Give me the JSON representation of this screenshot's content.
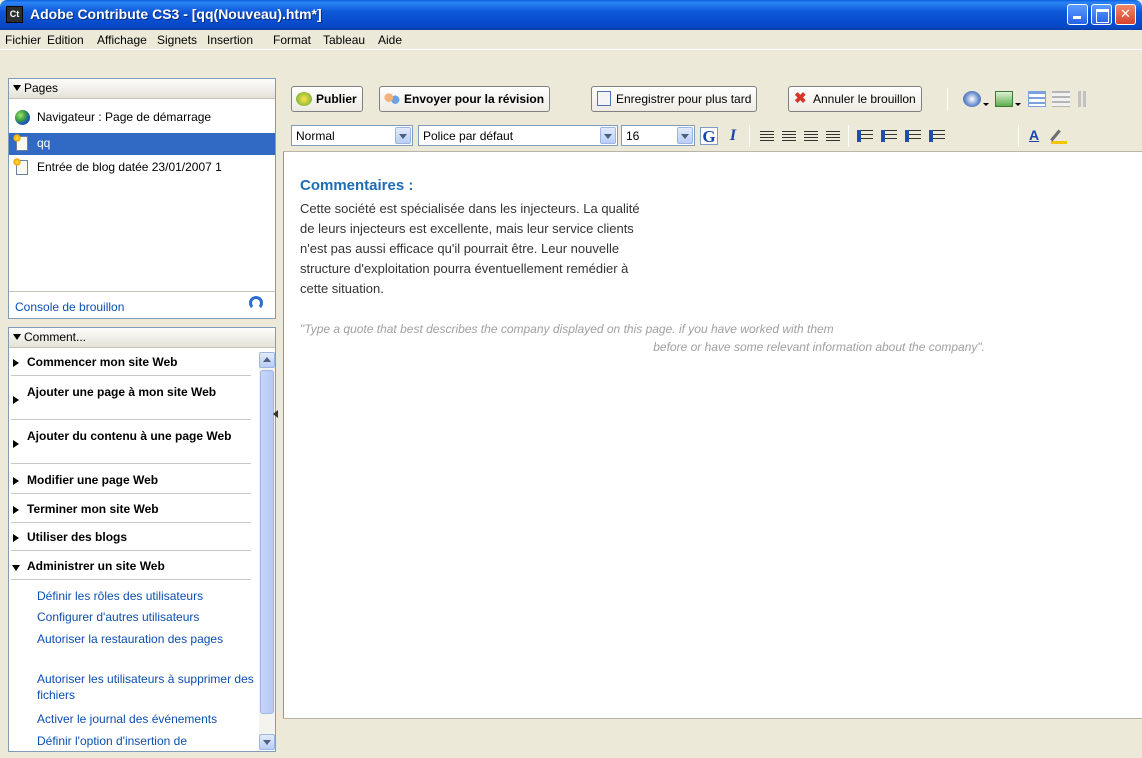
{
  "window": {
    "app_icon": "Ct",
    "title": "Adobe Contribute CS3 - [qq(Nouveau).htm*]"
  },
  "menu": [
    "Fichier",
    "Edition",
    "Affichage",
    "Signets",
    "Insertion",
    "Format",
    "Tableau",
    "Aide"
  ],
  "pages_panel": {
    "title": "Pages",
    "items": [
      {
        "label": "Navigateur : Page de démarrage",
        "icon": "globe-icon"
      },
      {
        "label": "qq",
        "icon": "new-page-icon",
        "selected": true
      },
      {
        "label": "Entrée de blog datée 23/01/2007 1",
        "icon": "new-page-icon"
      }
    ],
    "draft_console": "Console de brouillon"
  },
  "how_panel": {
    "title": "Comment...",
    "sections": [
      "Commencer mon site Web",
      "Ajouter une page à mon site Web",
      "Ajouter du contenu à une page Web",
      "Modifier une page Web",
      "Terminer mon site Web",
      "Utiliser des blogs",
      "Administrer un site Web"
    ],
    "links": [
      "Définir les rôles des utilisateurs",
      "Configurer d'autres utilisateurs",
      "Autoriser la restauration des pages",
      "Autoriser les utilisateurs à supprimer des fichiers",
      "Activer le journal des événements",
      "Définir l'option d'insertion de"
    ]
  },
  "toolbar": {
    "publish": "Publier",
    "send_review": "Envoyer pour la révision",
    "save_later": "Enregistrer pour plus tard",
    "cancel_draft": "Annuler le brouillon"
  },
  "format_bar": {
    "style": "Normal",
    "font": "Police par défaut",
    "size": "16",
    "bold": "G",
    "italic": "I",
    "color_letter": "A"
  },
  "document": {
    "heading": "Commentaires :",
    "paragraph": [
      "Cette société est spécialisée dans les injecteurs. La qualité",
      "de leurs injecteurs est excellente, mais leur service clients",
      "n'est pas aussi efficace qu'il pourrait être. Leur nouvelle",
      "structure d'exploitation pourra éventuellement remédier à",
      "cette situation."
    ],
    "quote": [
      "\"Type a quote that best describes the company displayed on this page. if you have worked with them",
      "before or have some relevant information about the company\"."
    ]
  },
  "colors": {
    "title_bar": "#0A5FE0",
    "selection": "#316AC5",
    "heading": "#1D6DB5",
    "link": "#0B4FB0"
  }
}
